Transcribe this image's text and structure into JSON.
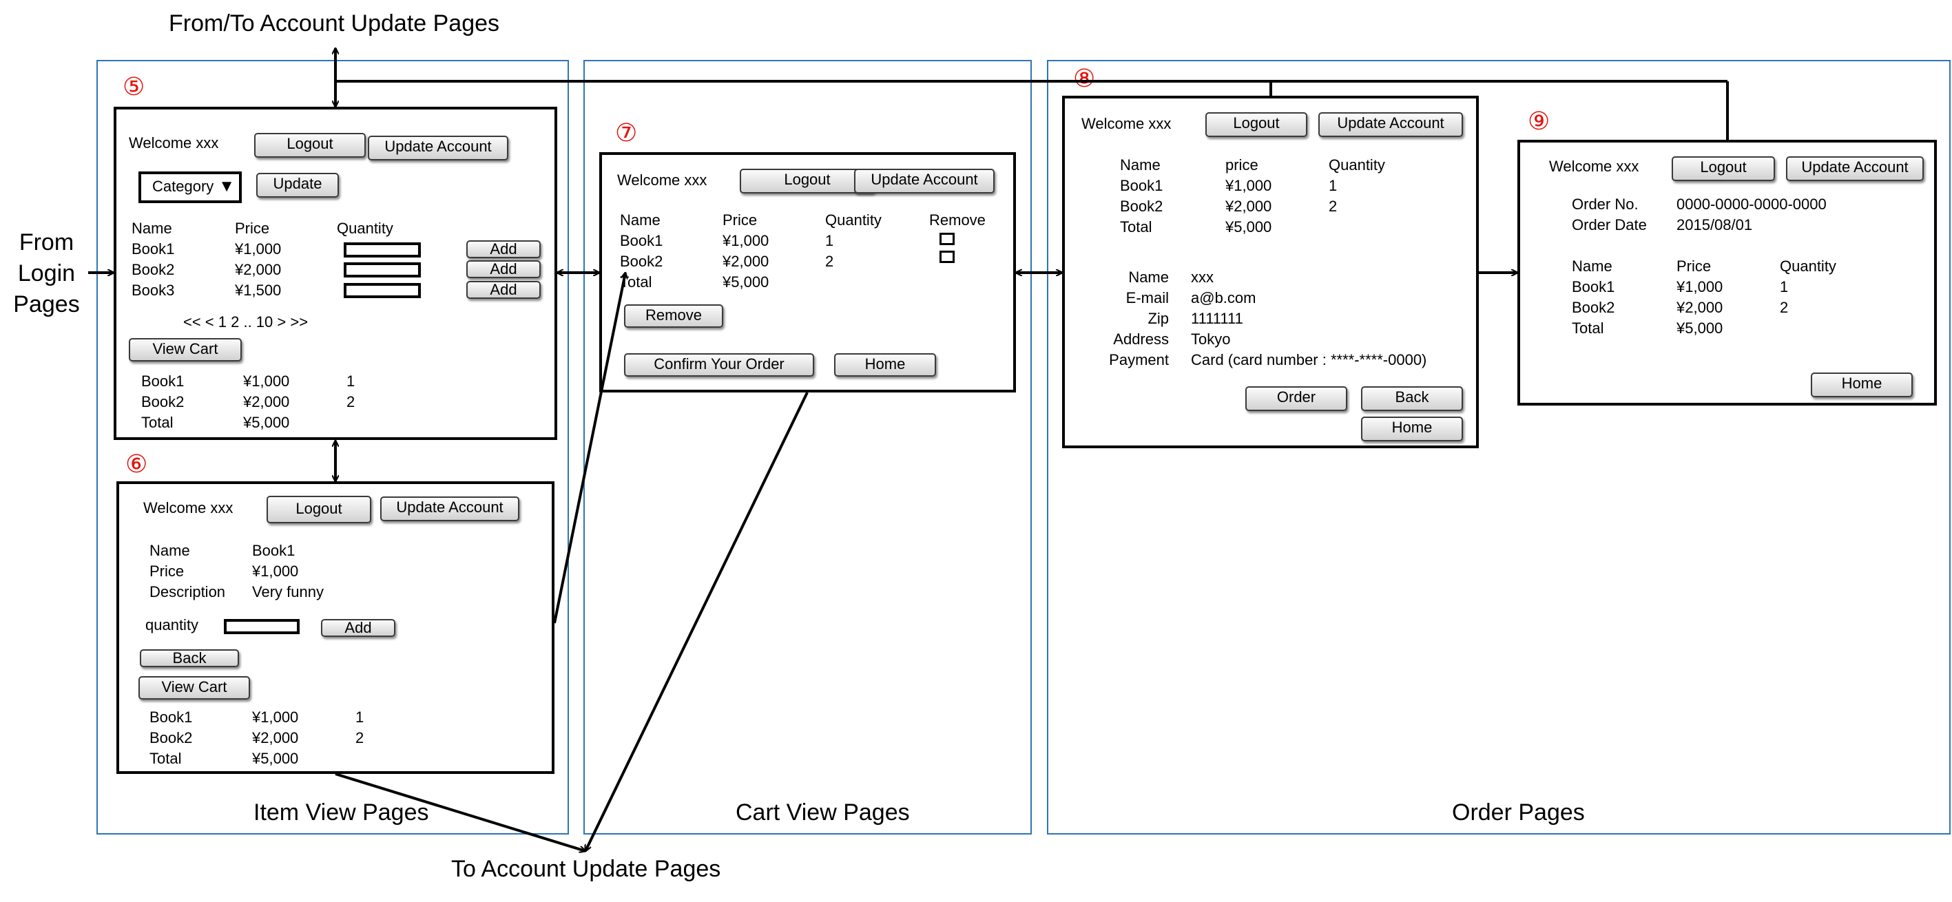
{
  "annotations": {
    "from_to_account": "From/To Account Update Pages",
    "to_account": "To Account Update Pages",
    "from_login": [
      "From",
      "Login",
      "Pages"
    ]
  },
  "sections": {
    "item_view": "Item View Pages",
    "cart_view": "Cart View Pages",
    "order": "Order Pages"
  },
  "badges": {
    "p5": "⑤",
    "p6": "⑥",
    "p7": "⑦",
    "p8": "⑧",
    "p9": "⑨"
  },
  "common": {
    "welcome": "Welcome  xxx",
    "welcome_tight": "Welcome xxx",
    "logout": "Logout",
    "update_account": "Update Account",
    "home": "Home"
  },
  "page5": {
    "category": "Category",
    "update": "Update",
    "headers": [
      "Name",
      "Price",
      "Quantity"
    ],
    "rows": [
      {
        "name": "Book1",
        "price": "¥1,000",
        "action": "Add"
      },
      {
        "name": "Book2",
        "price": "¥2,000",
        "action": "Add"
      },
      {
        "name": "Book3",
        "price": "¥1,500",
        "action": "Add"
      }
    ],
    "pagination": "<< < 1 2 .. 10 > >>",
    "view_cart": "View Cart",
    "cart": [
      [
        "Book1",
        "¥1,000",
        "1"
      ],
      [
        "Book2",
        "¥2,000",
        "2"
      ],
      [
        "Total",
        "¥5,000",
        ""
      ]
    ]
  },
  "page6": {
    "details": [
      [
        "Name",
        "Book1"
      ],
      [
        "Price",
        "¥1,000"
      ],
      [
        "Description",
        "Very funny"
      ]
    ],
    "quantity": "quantity",
    "add": "Add",
    "back": "Back",
    "view_cart": "View Cart",
    "cart": [
      [
        "Book1",
        "¥1,000",
        "1"
      ],
      [
        "Book2",
        "¥2,000",
        "2"
      ],
      [
        "Total",
        "¥5,000",
        ""
      ]
    ]
  },
  "page7": {
    "headers": [
      "Name",
      "Price",
      "Quantity",
      "Remove"
    ],
    "rows": [
      [
        "Book1",
        "¥1,000",
        "1"
      ],
      [
        "Book2",
        "¥2,000",
        "2"
      ],
      [
        "Total",
        "¥5,000",
        ""
      ]
    ],
    "remove": "Remove",
    "confirm": "Confirm Your Order"
  },
  "page8": {
    "headers": [
      "Name",
      "price",
      "Quantity"
    ],
    "rows": [
      [
        "Book1",
        "¥1,000",
        "1"
      ],
      [
        "Book2",
        "¥2,000",
        "2"
      ],
      [
        "Total",
        "¥5,000",
        ""
      ]
    ],
    "info": [
      [
        "Name",
        "xxx"
      ],
      [
        "E-mail",
        "a@b.com"
      ],
      [
        "Zip",
        "1111111"
      ],
      [
        "Address",
        "Tokyo"
      ],
      [
        "Payment",
        "Card (card number :  ****-****-0000)"
      ]
    ],
    "order": "Order",
    "back": "Back"
  },
  "page9": {
    "order_info": [
      [
        "Order No.",
        "0000-0000-0000-0000"
      ],
      [
        "Order Date",
        "2015/08/01"
      ]
    ],
    "headers": [
      "Name",
      "Price",
      "Quantity"
    ],
    "rows": [
      [
        "Book1",
        "¥1,000",
        "1"
      ],
      [
        "Book2",
        "¥2,000",
        "2"
      ],
      [
        "Total",
        "¥5,000",
        ""
      ]
    ]
  }
}
